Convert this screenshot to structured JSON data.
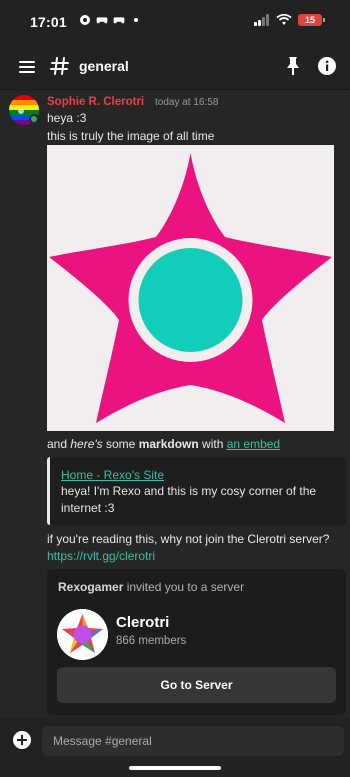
{
  "status_bar": {
    "time": "17:01",
    "battery": "15"
  },
  "header": {
    "channel": "general"
  },
  "message": {
    "author": "Sophie R. Clerotri",
    "timestamp": "today at 16:58",
    "line1": "heya :3",
    "line2": "this is truly the image of all time",
    "md_part1": "and ",
    "md_italic": "here's",
    "md_part2": " some ",
    "md_bold": "markdown",
    "md_part3": " with ",
    "md_link": "an embed"
  },
  "embed": {
    "title": "Home - Rexo's Site",
    "description": "heya! I'm Rexo and this is my cosy corner of the internet :3"
  },
  "message2": {
    "text": "if you're reading this, why not join the Clerotri server? ",
    "link": "https://rvlt.gg/clerotri"
  },
  "invite": {
    "inviter": "Rexogamer",
    "heading_rest": " invited you to a server",
    "server_name": "Clerotri",
    "members": "866 members",
    "button_label": "Go to Server"
  },
  "composer": {
    "placeholder": "Message #general"
  },
  "colors": {
    "star": "#ea137f",
    "circle": "#12cdb9",
    "author": "#e8424c",
    "link": "#3bbfa8"
  }
}
